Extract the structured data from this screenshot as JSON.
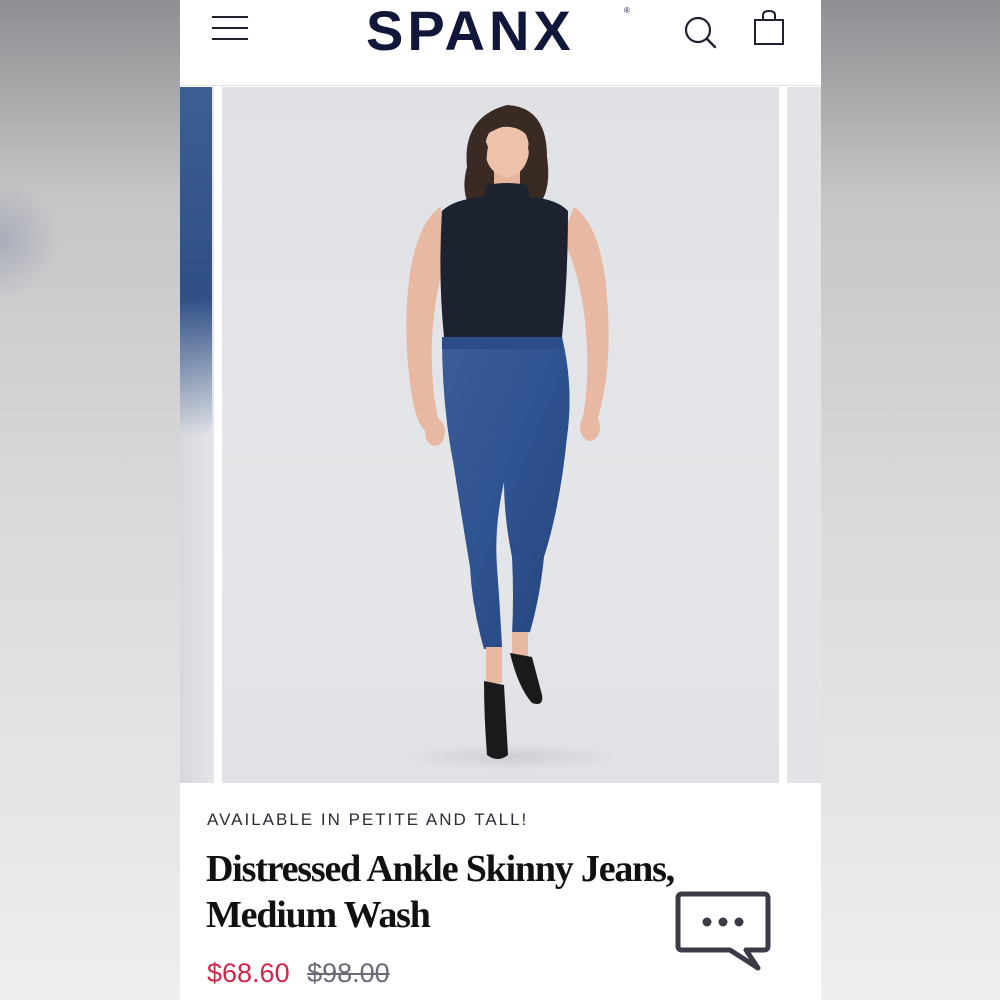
{
  "header": {
    "brand": "SPANX",
    "brand_mark": "®",
    "icons": [
      "menu-icon",
      "search-icon",
      "shopping-bag-icon"
    ]
  },
  "product": {
    "tagline": "AVAILABLE IN PETITE AND TALL!",
    "title_line1": "Distressed Ankle Skinny Jeans,",
    "title_line2": "Medium Wash",
    "price_sale": "$68.60",
    "price_original": "$98.00"
  },
  "chat": {
    "icon": "chat-bubble-icon"
  },
  "colors": {
    "brand_navy": "#10173a",
    "sale_red": "#d0254a",
    "denim_blue": "#34568f"
  }
}
